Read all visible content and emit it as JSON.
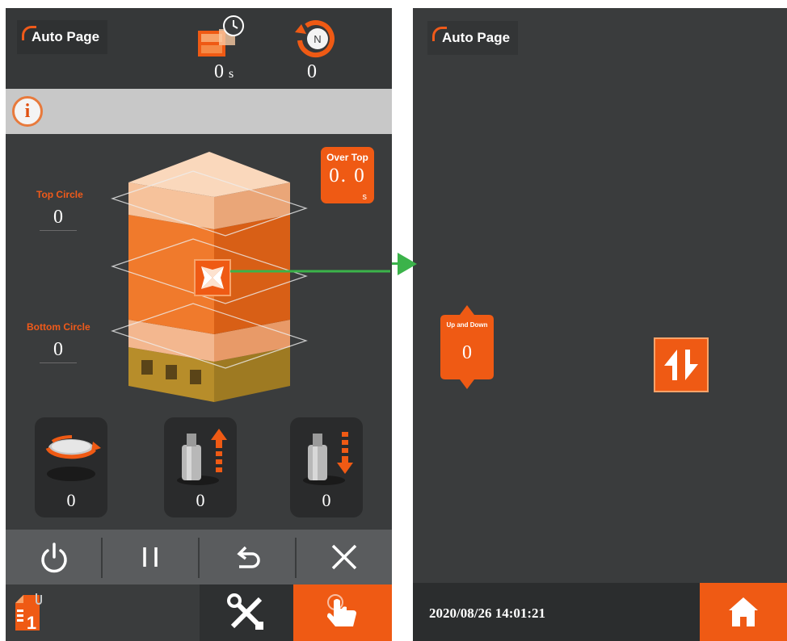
{
  "left": {
    "header": {
      "title": "Auto Page",
      "timer_value": "0",
      "timer_unit": "s",
      "count_value": "0",
      "count_icon_letter": "N"
    },
    "info_icon": "i",
    "top_circle": {
      "label": "Top Circle",
      "value": "0"
    },
    "bottom_circle": {
      "label": "Bottom Circle",
      "value": "0"
    },
    "over_top": {
      "label": "Over Top",
      "value": "0. 0",
      "unit": "s"
    },
    "motors": [
      {
        "icon": "turntable-rotate-icon",
        "value": "0"
      },
      {
        "icon": "carriage-up-icon",
        "value": "0"
      },
      {
        "icon": "carriage-down-icon",
        "value": "0"
      }
    ],
    "toolbar": [
      "power-icon",
      "pause-icon",
      "undo-icon",
      "close-icon"
    ],
    "bottom_nav": {
      "doc_number": "1"
    }
  },
  "right": {
    "header": {
      "title": "Auto Page"
    },
    "up_and_down": {
      "label": "Up and Down",
      "value": "0"
    },
    "datetime": "2020/08/26 14:01:21"
  },
  "colors": {
    "accent": "#ef5a14",
    "panel_bg": "#3a3c3d",
    "toolbar_bg": "#5a5c5e",
    "info_bar_bg": "#c8c8c8",
    "arrow_green": "#3bb34a"
  }
}
